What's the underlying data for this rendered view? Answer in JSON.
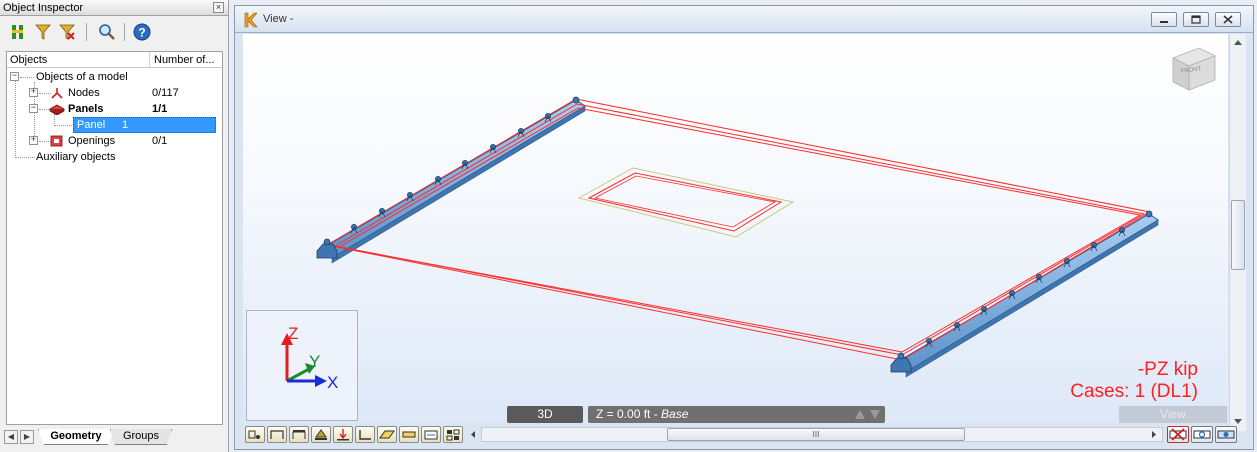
{
  "inspector": {
    "title": "Object Inspector",
    "close_glyph": "×",
    "toolbar_icons": [
      "object-list-icon",
      "filter-icon",
      "filter-clear-icon",
      "search-icon",
      "help-icon"
    ],
    "columns": {
      "objects": "Objects",
      "number": "Number of..."
    },
    "tree": {
      "root": "Objects of a model",
      "nodes": {
        "label": "Nodes",
        "count": "0/117"
      },
      "panels": {
        "label": "Panels",
        "count": "1/1"
      },
      "panel_item": {
        "label": "Panel",
        "number": "1"
      },
      "openings": {
        "label": "Openings",
        "count": "0/1"
      },
      "auxiliary": "Auxiliary objects"
    },
    "tabs": {
      "geometry": "Geometry",
      "groups": "Groups"
    }
  },
  "view": {
    "title": "View -",
    "cube_face": "FRONT",
    "axes": {
      "z": "Z",
      "y": "Y",
      "x": "X"
    },
    "load_label": {
      "line1": "-PZ  kip",
      "line2": "Cases: 1 (DL1)"
    },
    "status": {
      "mode": "3D",
      "level": "Z = 0.00 ft - ",
      "level_name": "Base",
      "view_label": "View"
    },
    "scroll_grip": "III"
  },
  "colors": {
    "panel_edge": "#ff2a2a",
    "opening_edge": "#c8c87a",
    "support": "#6fa3d8",
    "load_text": "#ff2020",
    "axis_x": "#1a2bd6",
    "axis_y": "#1a8a2a",
    "axis_z": "#e02020"
  }
}
